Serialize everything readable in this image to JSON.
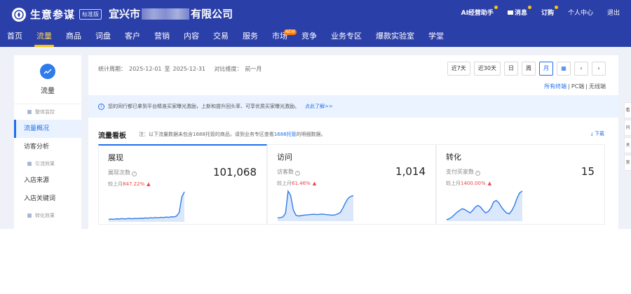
{
  "brand": {
    "name": "生意参谋",
    "edition": "标准版"
  },
  "company": {
    "prefix": "宜兴市",
    "suffix": "有限公司"
  },
  "top_links": {
    "ai_assistant": "AI经营助手",
    "messages": "消息",
    "subscribe": "订购",
    "personal_center": "个人中心",
    "logout": "退出"
  },
  "nav": [
    {
      "label": "首页"
    },
    {
      "label": "流量"
    },
    {
      "label": "商品"
    },
    {
      "label": "词盘"
    },
    {
      "label": "客户"
    },
    {
      "label": "营销"
    },
    {
      "label": "内容"
    },
    {
      "label": "交易"
    },
    {
      "label": "服务"
    },
    {
      "label": "市场",
      "badge": "NEW"
    },
    {
      "label": "竞争"
    },
    {
      "label": "业务专区"
    },
    {
      "label": "爆款实验室"
    },
    {
      "label": "学堂"
    }
  ],
  "sidebar": {
    "title": "流量",
    "items": [
      {
        "type": "group",
        "label": "整体监控"
      },
      {
        "type": "item",
        "label": "流量概况",
        "active": true
      },
      {
        "type": "item",
        "label": "访客分析"
      },
      {
        "type": "group",
        "label": "引流效果"
      },
      {
        "type": "item",
        "label": "入店来源"
      },
      {
        "type": "item",
        "label": "入店关键词"
      },
      {
        "type": "group",
        "label": "转化效果"
      }
    ]
  },
  "period": {
    "label": "统计周期：",
    "start": "2025-12-01",
    "sep": "至",
    "end": "2025-12-31",
    "compare_label": "对比维度：",
    "compare_value": "前一月"
  },
  "date_buttons": [
    {
      "label": "近7天"
    },
    {
      "label": "近30天"
    },
    {
      "label": "日"
    },
    {
      "label": "周"
    },
    {
      "label": "月",
      "active": true
    }
  ],
  "terminals": {
    "all": "所有终端",
    "pc": "PC端",
    "wireless": "无线端",
    "sep": "|"
  },
  "notice": {
    "text": "您的同行都已拿到平台精准买家曝光激励，上新和提升回头率、可享优质买家曝光激励。",
    "link": "点此了解>>"
  },
  "board": {
    "title": "流量看板",
    "note_prefix": "注：以下流量数据未包含1688托管的商品，请到业务专区查看",
    "note_link": "1688托管",
    "note_suffix": "的明细数据。",
    "download": "下载"
  },
  "cards": [
    {
      "title": "展现",
      "metric_label": "展现次数",
      "value": "101,068",
      "compare_label": "较上月",
      "compare_pct": "847.22%",
      "active": true
    },
    {
      "title": "访问",
      "metric_label": "访客数",
      "value": "1,014",
      "compare_label": "较上月",
      "compare_pct": "61.46%",
      "active": false
    },
    {
      "title": "转化",
      "metric_label": "支付买家数",
      "value": "15",
      "compare_label": "较上月",
      "compare_pct": "1400.00%",
      "active": false
    }
  ],
  "chart_data": [
    {
      "type": "area",
      "series": [
        {
          "values": [
            2,
            2.5,
            2.2,
            2.8,
            2.4,
            3.1,
            2.6,
            2.9,
            3.3,
            2.7,
            3.4,
            3.0,
            3.6,
            3.2,
            3.8,
            3.5,
            4.0,
            3.7,
            4.3,
            3.9,
            4.5,
            4.2,
            4.8,
            4.4,
            5.2,
            4.9,
            6.0,
            10,
            28,
            34
          ]
        }
      ]
    },
    {
      "type": "area",
      "series": [
        {
          "values": [
            3,
            3.2,
            4,
            8,
            33,
            28,
            12,
            6,
            5,
            5.5,
            6,
            6.2,
            6.5,
            6.8,
            7,
            6.6,
            6.9,
            7.2,
            6.8,
            6.5,
            6.2,
            6.0,
            6.3,
            7.5,
            9,
            14,
            20,
            25,
            27,
            28
          ]
        }
      ]
    },
    {
      "type": "area",
      "series": [
        {
          "values": [
            1,
            2,
            4,
            7,
            10,
            12,
            14,
            13,
            11,
            9,
            12,
            16,
            18,
            16,
            12,
            9,
            11,
            15,
            22,
            24,
            21,
            16,
            12,
            9,
            8,
            12,
            18,
            27,
            33,
            35
          ]
        }
      ]
    }
  ],
  "right_rail": [
    "看",
    "问",
    "关",
    "常"
  ],
  "colors": {
    "header": "#2b3fa8",
    "accent": "#1f6ef0",
    "up": "#f04142",
    "active_nav": "#ffc400"
  }
}
